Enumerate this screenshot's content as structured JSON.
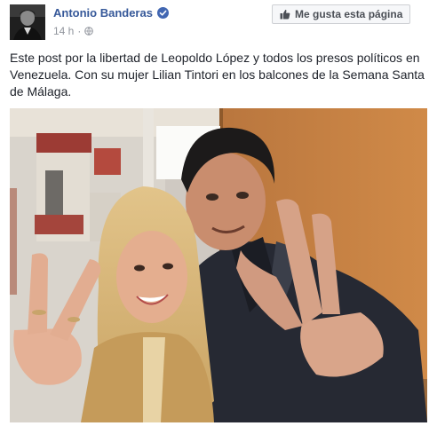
{
  "post": {
    "author": "Antonio Banderas",
    "timestamp": "14 h",
    "separator": "·",
    "like_button_label": "Me gusta esta página",
    "text": "Este post por la libertad de Leopoldo López y todos los presos políticos en Venezuela. Con su mujer Lilian Tintori en los balcones de la Semana Santa de Málaga.",
    "icons": {
      "verified": "verified-badge-icon",
      "privacy": "globe-icon",
      "like": "thumbs-up-icon"
    }
  },
  "colors": {
    "link": "#365899",
    "meta": "#90949c",
    "text": "#1d2129",
    "verified": "#4267b2"
  }
}
